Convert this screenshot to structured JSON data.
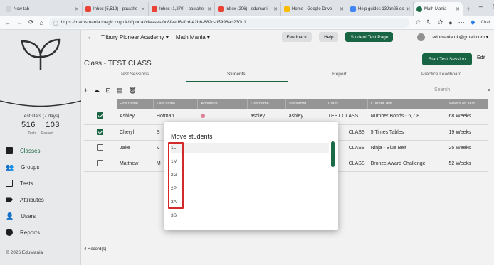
{
  "browser": {
    "tabs": [
      {
        "title": "New tab",
        "icon": "newtab-icon",
        "color": "#777777"
      },
      {
        "title": "Inbox (5,519) - paulahe",
        "icon": "gmail-icon",
        "color": "#ea4335"
      },
      {
        "title": "Inbox (1,270) - paulahe",
        "icon": "gmail-icon",
        "color": "#ea4335"
      },
      {
        "title": "Inbox (206) - edumani",
        "icon": "gmail-icon",
        "color": "#ea4335"
      },
      {
        "title": "Home - Google Drive",
        "icon": "drive-icon",
        "color": "#fbbc04"
      },
      {
        "title": "Help guides 13Jan26.do",
        "icon": "docs-icon",
        "color": "#4285f4"
      },
      {
        "title": "Math Mania",
        "icon": "mathmania-icon",
        "color": "#1b6b47"
      }
    ],
    "url": "https://mathsmania.theglc.org.uk/#/portal/classes/0c8feed6-ffcd-42b6-882c-d5998ad230d1",
    "profile_label": "Chal"
  },
  "sidebar": {
    "stats_title": "Test stats (7 days)",
    "tests_count": "516",
    "passed_count": "103",
    "tests_label": "Tests",
    "passed_label": "Passed",
    "nav": [
      {
        "label": "Classes",
        "icon": "classes-icon"
      },
      {
        "label": "Groups",
        "icon": "groups-icon"
      },
      {
        "label": "Tests",
        "icon": "tests-icon"
      },
      {
        "label": "Attributes",
        "icon": "tag-icon"
      },
      {
        "label": "Users",
        "icon": "users-icon"
      },
      {
        "label": "Reports",
        "icon": "reports-icon"
      }
    ],
    "footer": "© 2026 EduMania"
  },
  "topnav": {
    "school": "Tilbury Pioneer Academy",
    "app": "Math Mania",
    "feedback": "Feedback",
    "help": "Help",
    "student_test_page": "Student Test Page",
    "email": "edumania.uk@gmail.com"
  },
  "page": {
    "class_title": "Class - TEST CLASS",
    "start_test_session": "Start Test Session",
    "edit": "Edit",
    "tabs": [
      "Test Sessions",
      "Students",
      "Report",
      "Practice Leadboard"
    ],
    "active_tab": "Students",
    "search_placeholder": "Search",
    "records": "4 Record(s)"
  },
  "table": {
    "headers": [
      "First name",
      "Last name",
      "Attributes",
      "Username",
      "Password",
      "Class",
      "Current Test",
      "Weeks on Test"
    ],
    "rows": [
      {
        "checked": true,
        "first": "Ashley",
        "last": "Hofman",
        "attr_dot": true,
        "username": "ashley",
        "password": "ashley",
        "class": "TEST CLASS",
        "test": "Number Bonds - 6,7,8",
        "weeks": "68 Weeks"
      },
      {
        "checked": true,
        "first": "Cheryl",
        "last": "S",
        "attr_dot": false,
        "username": "",
        "password": "",
        "class": "CLASS",
        "test": "5 Times Tables",
        "weeks": "19 Weeks"
      },
      {
        "checked": false,
        "first": "Jake",
        "last": "V",
        "attr_dot": false,
        "username": "",
        "password": "",
        "class": "CLASS",
        "test": "Ninja - Blue Belt",
        "weeks": "25 Weeks"
      },
      {
        "checked": false,
        "first": "Matthew",
        "last": "M",
        "attr_dot": false,
        "username": "",
        "password": "",
        "class": "CLASS",
        "test": "Bronze Award Challenge",
        "weeks": "52 Weeks"
      }
    ]
  },
  "modal": {
    "title": "Move students",
    "options": [
      "1L",
      "1M",
      "2G",
      "2P",
      "3A",
      "3S"
    ]
  },
  "colors": {
    "brand": "#1b6b47",
    "highlight": "#d22a2a",
    "attribute_dot": "#e88aa0"
  }
}
